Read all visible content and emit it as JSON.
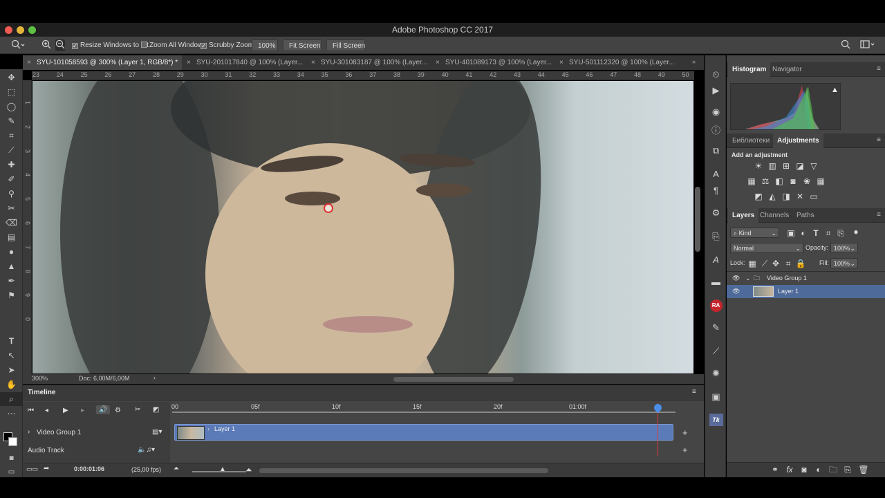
{
  "app": {
    "title": "Adobe Photoshop CC 2017"
  },
  "options": {
    "resize_windows": "Resize Windows to Fit",
    "zoom_all": "Zoom All Windows",
    "scrubby_zoom": "Scrubby Zoom",
    "zoom_value": "100%",
    "fit_screen_1": "Fit Screen",
    "fill_screen": "Fill Screen"
  },
  "tabs": [
    {
      "label": "SYU-101058593 @ 300% (Layer 1, RGB/8*) *"
    },
    {
      "label": "SYU-201017840 @ 100% (Layer..."
    },
    {
      "label": "SYU-301083187 @ 100% (Layer..."
    },
    {
      "label": "SYU-401089173 @ 100% (Layer..."
    },
    {
      "label": "SYU-501112320 @ 100% (Layer..."
    }
  ],
  "ruler_top": [
    "23",
    "24",
    "25",
    "26",
    "27",
    "28",
    "29",
    "30",
    "31",
    "32",
    "33",
    "34",
    "35",
    "36",
    "37",
    "38",
    "39",
    "40",
    "41",
    "42",
    "43",
    "44",
    "45",
    "46",
    "47",
    "48",
    "49",
    "50"
  ],
  "ruler_left": [
    "1",
    "2",
    "3",
    "4",
    "5",
    "6",
    "7",
    "8",
    "9",
    "0"
  ],
  "status": {
    "zoom": "300%",
    "doc": "Doc: 6,00M/6,00M"
  },
  "timeline": {
    "title": "Timeline",
    "frames": [
      "00",
      "05f",
      "10f",
      "15f",
      "20f",
      "01:00f"
    ],
    "group": "Video Group 1",
    "layer": "Layer 1",
    "audio": "Audio Track",
    "time": "0:00:01:06",
    "fps": "(25,00 fps)"
  },
  "panels": {
    "histogram_tab": "Histogram",
    "navigator_tab": "Navigator",
    "libraries_tab": "Библиотеки",
    "adjustments_tab": "Adjustments",
    "add_adjustment": "Add an adjustment",
    "layers_tab": "Layers",
    "channels_tab": "Channels",
    "paths_tab": "Paths",
    "kind": "Kind",
    "blend_mode": "Normal",
    "opacity_label": "Opacity:",
    "opacity_value": "100%",
    "lock_label": "Lock:",
    "fill_label": "Fill:",
    "fill_value": "100%",
    "layer_group": "Video Group 1",
    "layer_item": "Layer 1"
  },
  "toolbar_icons": [
    "move-icon",
    "marquee-icon",
    "lasso-icon",
    "quick-select-icon",
    "crop-icon",
    "eyedropper-icon",
    "healing-icon",
    "brush-icon",
    "clone-stamp-icon",
    "history-brush-icon",
    "eraser-icon",
    "gradient-icon",
    "blur-icon",
    "dodge-icon",
    "pen-icon",
    "type-icon",
    "path-select-icon",
    "shape-icon",
    "hand-icon",
    "zoom-icon"
  ],
  "colors": {
    "accent": "#5a7ab8",
    "layer_selected": "#4e6a9a",
    "playhead": "#e03a3a"
  }
}
